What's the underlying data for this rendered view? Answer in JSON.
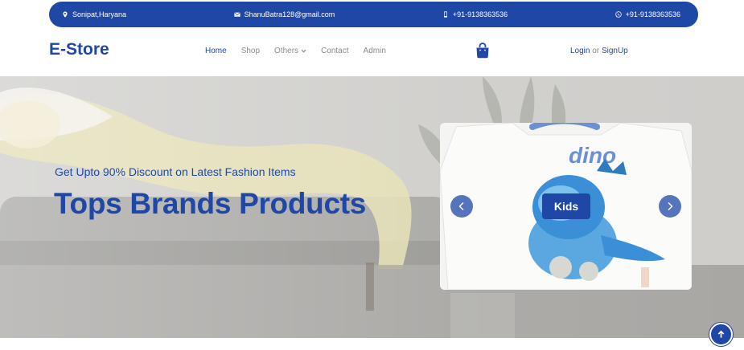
{
  "topbar": {
    "location": "Sonipat,Haryana",
    "email": "ShanuBatra128@gmail.com",
    "phone": "+91-9138363536",
    "whatsapp": "+91-9138363536"
  },
  "brand": {
    "logo": "E-Store"
  },
  "nav": {
    "items": [
      {
        "label": "Home",
        "active": true
      },
      {
        "label": "Shop"
      },
      {
        "label": "Others",
        "dropdown": true
      },
      {
        "label": "Contact"
      },
      {
        "label": "Admin"
      }
    ]
  },
  "auth": {
    "login": "Login",
    "separator": "or",
    "signup": "SignUp"
  },
  "hero": {
    "subtitle": "Get Upto 90% Discount on Latest Fashion Items",
    "title": "Tops Brands Products",
    "carousel": {
      "caption": "Kids"
    }
  },
  "theme": {
    "primary": "#1f47a5"
  },
  "icons": {
    "location": "map-pin-icon",
    "email": "envelope-icon",
    "phone": "mobile-phone-icon",
    "whatsapp": "whatsapp-icon",
    "cart": "shopping-bag-icon",
    "back_to_top": "arrow-up-icon"
  }
}
